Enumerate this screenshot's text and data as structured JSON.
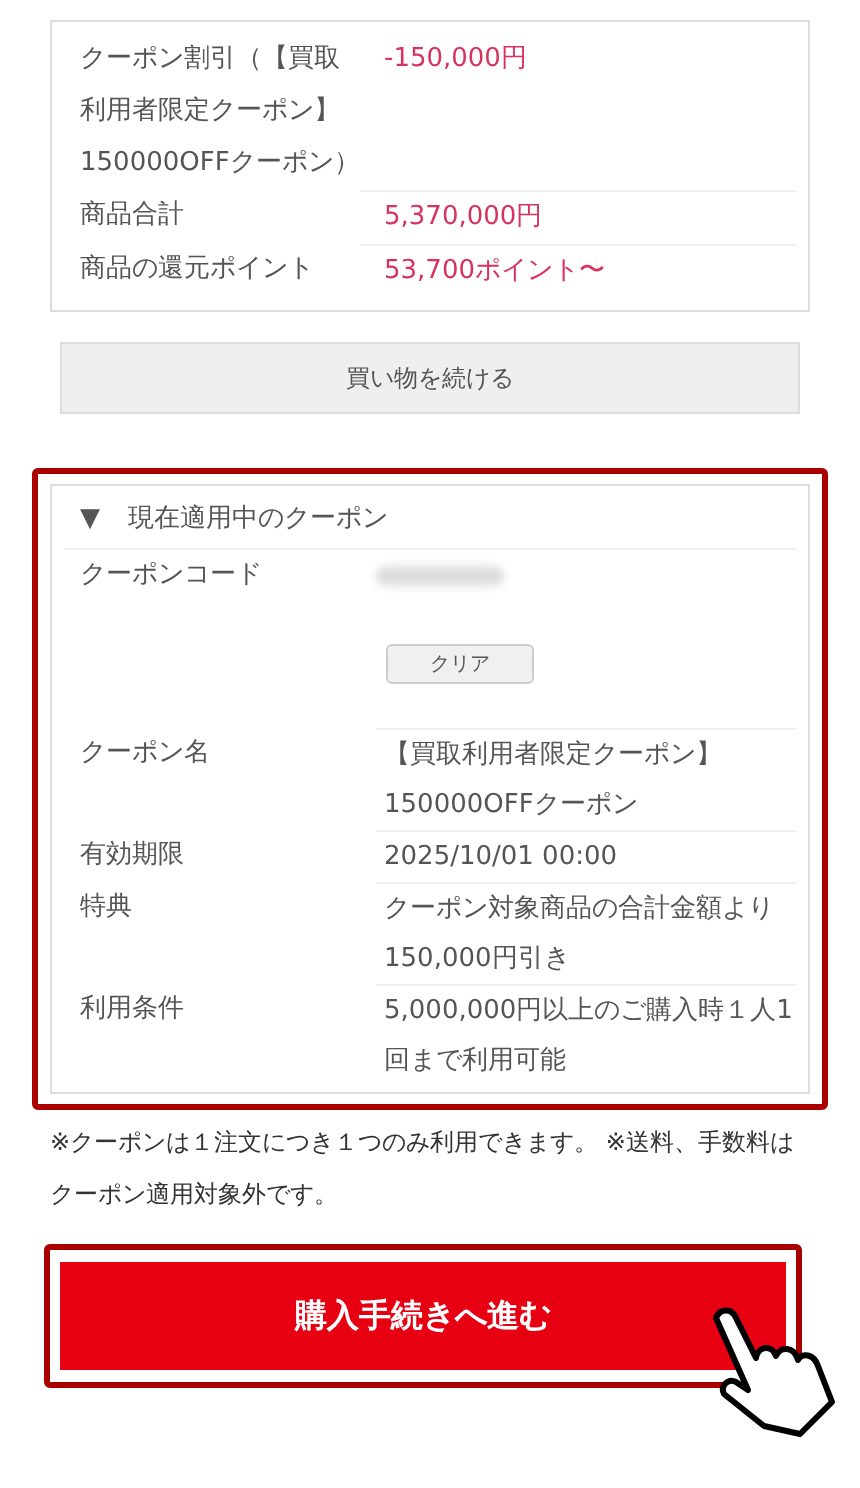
{
  "summary": {
    "rows": [
      {
        "label": "クーポン割引（【買取利用者限定クーポン】150000OFFクーポン）",
        "value": "-150,000円"
      },
      {
        "label": "商品合計",
        "value": "5,370,000円"
      },
      {
        "label": "商品の還元ポイント",
        "value": "53,700ポイント〜"
      }
    ]
  },
  "continue_button": "買い物を続ける",
  "coupon": {
    "toggle": "▼",
    "title": "現在適用中のクーポン",
    "code_label": "クーポンコード",
    "clear_button": "クリア",
    "rows": [
      {
        "label": "クーポン名",
        "value": "【買取利用者限定クーポン】150000OFFクーポン"
      },
      {
        "label": "有効期限",
        "value": "2025/10/01 00:00"
      },
      {
        "label": "特典",
        "value": "クーポン対象商品の合計金額より150,000円引き"
      },
      {
        "label": "利用条件",
        "value": "5,000,000円以上のご購入時１人1回まで利用可能"
      }
    ]
  },
  "note": "※クーポンは１注文につき１つのみ利用できます。 ※送料、手数料はクーポン適用対象外です。",
  "purchase_button": "購入手続きへ進む"
}
